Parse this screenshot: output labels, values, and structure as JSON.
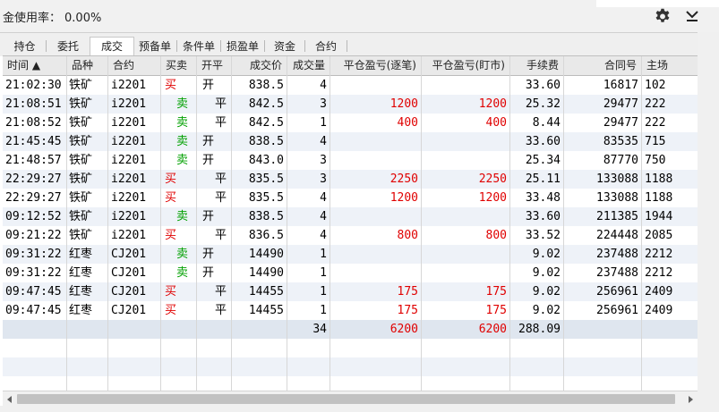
{
  "header": {
    "margin_label": "金使用率：",
    "margin_value": "0.00%"
  },
  "tabs": [
    {
      "label": "持仓"
    },
    {
      "label": "委托"
    },
    {
      "label": "成交",
      "active": true
    },
    {
      "label": "预备单"
    },
    {
      "label": "条件单"
    },
    {
      "label": "损盈单"
    },
    {
      "label": "资金"
    },
    {
      "label": "合约"
    }
  ],
  "table": {
    "columns": [
      {
        "label": "时间 ▲"
      },
      {
        "label": "品种"
      },
      {
        "label": "合约"
      },
      {
        "label": "买卖"
      },
      {
        "label": "开平"
      },
      {
        "label": "成交价"
      },
      {
        "label": "成交量"
      },
      {
        "label": "平仓盈亏(逐笔)"
      },
      {
        "label": "平仓盈亏(盯市)"
      },
      {
        "label": "手续费"
      },
      {
        "label": "合同号"
      },
      {
        "label": "主场"
      }
    ],
    "rows": [
      [
        "21:02:30",
        "铁矿",
        "i2201",
        "买",
        "开",
        "838.5",
        "4",
        "",
        "",
        "33.60",
        "16817",
        "102"
      ],
      [
        "21:08:51",
        "铁矿",
        "i2201",
        "卖",
        "平",
        "842.5",
        "3",
        "1200",
        "1200",
        "25.32",
        "29477",
        "222"
      ],
      [
        "21:08:52",
        "铁矿",
        "i2201",
        "卖",
        "平",
        "842.5",
        "1",
        "400",
        "400",
        "8.44",
        "29477",
        "222"
      ],
      [
        "21:45:45",
        "铁矿",
        "i2201",
        "卖",
        "开",
        "838.5",
        "4",
        "",
        "",
        "33.60",
        "83535",
        "715"
      ],
      [
        "21:48:57",
        "铁矿",
        "i2201",
        "卖",
        "开",
        "843.0",
        "3",
        "",
        "",
        "25.34",
        "87770",
        "750"
      ],
      [
        "22:29:27",
        "铁矿",
        "i2201",
        "买",
        "平",
        "835.5",
        "3",
        "2250",
        "2250",
        "25.11",
        "133088",
        "1188"
      ],
      [
        "22:29:27",
        "铁矿",
        "i2201",
        "买",
        "平",
        "835.5",
        "4",
        "1200",
        "1200",
        "33.48",
        "133088",
        "1188"
      ],
      [
        "09:12:52",
        "铁矿",
        "i2201",
        "卖",
        "开",
        "838.5",
        "4",
        "",
        "",
        "33.60",
        "211385",
        "1944"
      ],
      [
        "09:21:22",
        "铁矿",
        "i2201",
        "买",
        "平",
        "836.5",
        "4",
        "800",
        "800",
        "33.52",
        "224448",
        "2085"
      ],
      [
        "09:31:22",
        "红枣",
        "CJ201",
        "卖",
        "开",
        "14490",
        "1",
        "",
        "",
        "9.02",
        "237488",
        "2212"
      ],
      [
        "09:31:22",
        "红枣",
        "CJ201",
        "卖",
        "开",
        "14490",
        "1",
        "",
        "",
        "9.02",
        "237488",
        "2212"
      ],
      [
        "09:47:45",
        "红枣",
        "CJ201",
        "买",
        "平",
        "14455",
        "1",
        "175",
        "175",
        "9.02",
        "256961",
        "2409"
      ],
      [
        "09:47:45",
        "红枣",
        "CJ201",
        "买",
        "平",
        "14455",
        "1",
        "175",
        "175",
        "9.02",
        "256961",
        "2409"
      ]
    ],
    "summary": {
      "volume": "34",
      "pnl_trade": "6200",
      "pnl_mark": "6200",
      "fee": "288.09"
    }
  },
  "icons": {
    "settings": "gear-icon",
    "minimize": "chevron-down-icon"
  },
  "colors": {
    "buy": "#e00000",
    "sell": "#00a000",
    "profit": "#e00000",
    "alt_row": "#eef2f8"
  }
}
